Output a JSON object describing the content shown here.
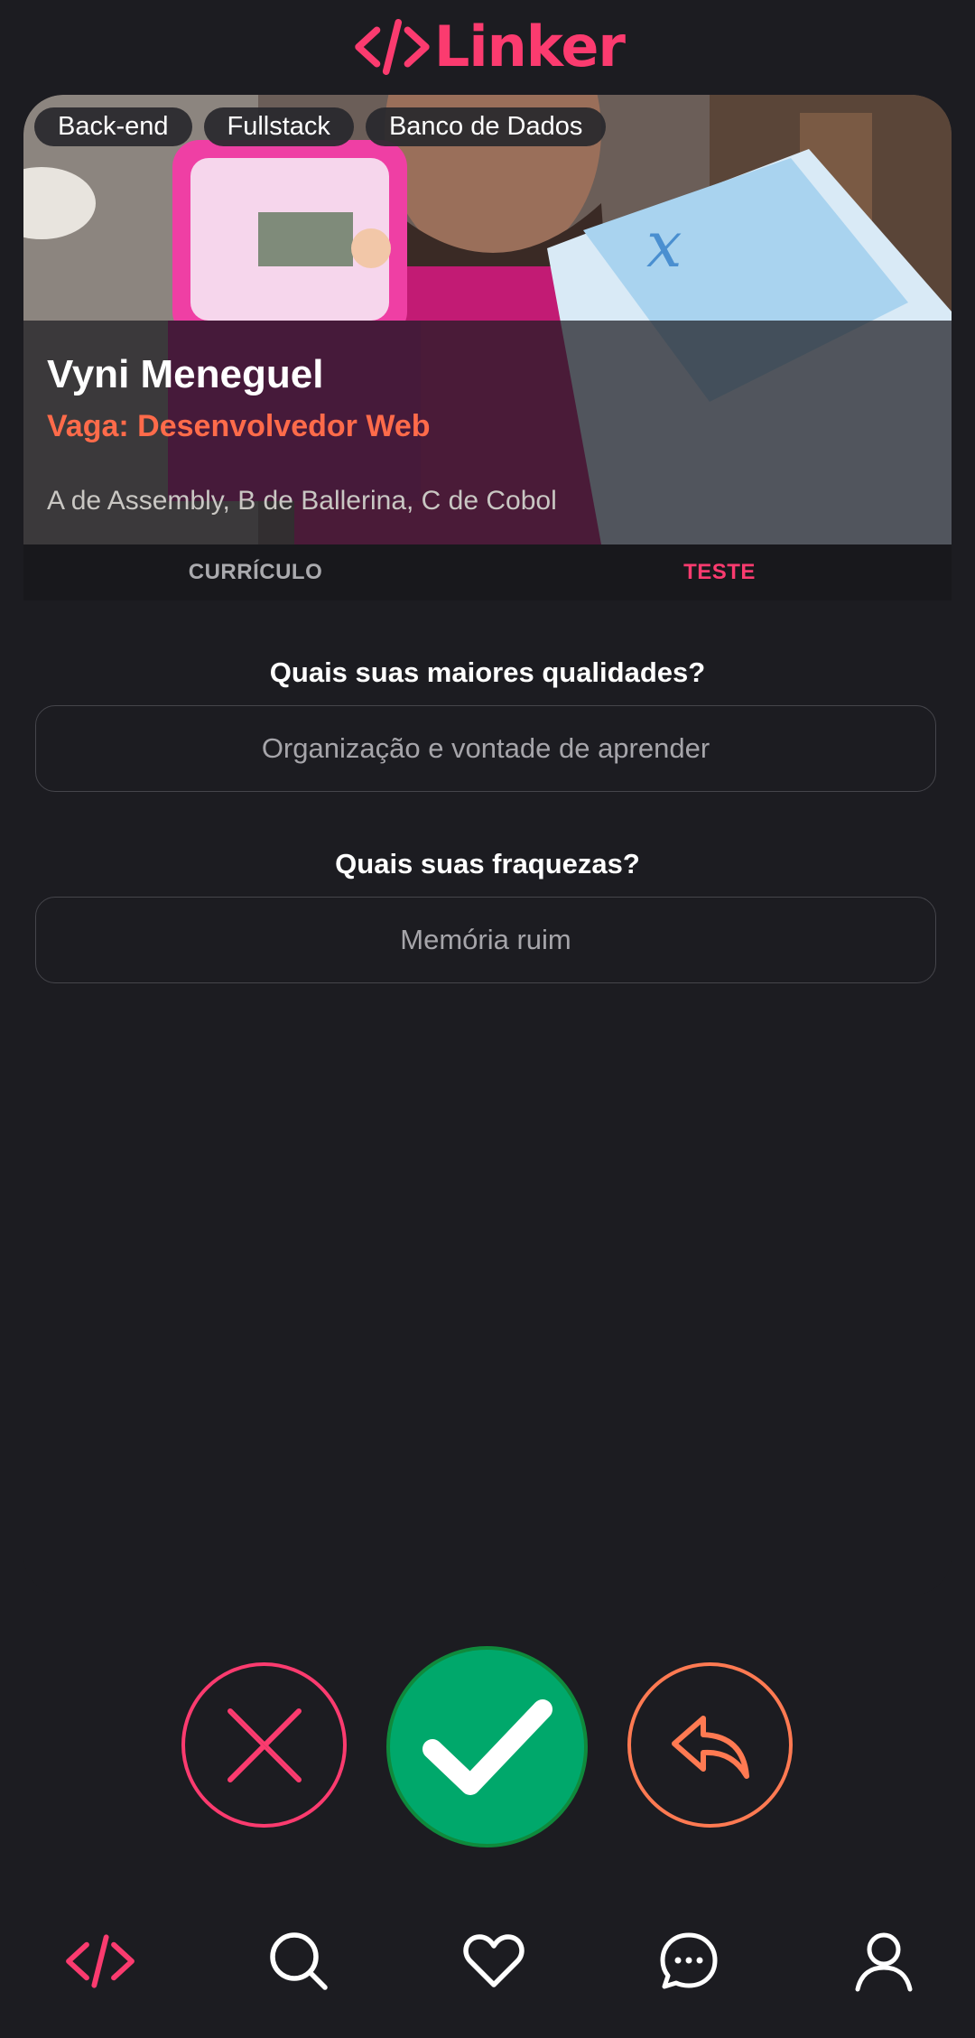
{
  "app": {
    "name": "Linker",
    "brand_color": "#fb3b6f",
    "accent_color": "#ff6b4a",
    "success_color": "#00a86b"
  },
  "profile": {
    "tags": [
      "Back-end",
      "Fullstack",
      "Banco de Dados"
    ],
    "name": "Vyni Meneguel",
    "job": "Vaga: Desenvolvedor Web",
    "bio": "A de Assembly, B de Ballerina, C de Cobol"
  },
  "tabs": [
    {
      "label": "CURRÍCULO",
      "active": false
    },
    {
      "label": "TESTE",
      "active": true
    }
  ],
  "test": {
    "questions": [
      {
        "question": "Quais suas maiores qualidades?",
        "answer": "Organização e vontade de aprender"
      },
      {
        "question": "Quais suas fraquezas?",
        "answer": "Memória ruim"
      }
    ]
  },
  "actions": {
    "reject_icon": "close-icon",
    "accept_icon": "check-icon",
    "back_icon": "undo-icon"
  },
  "bottom_nav": [
    {
      "icon": "code-icon",
      "active": true
    },
    {
      "icon": "search-icon",
      "active": false
    },
    {
      "icon": "heart-icon",
      "active": false
    },
    {
      "icon": "chat-icon",
      "active": false
    },
    {
      "icon": "user-icon",
      "active": false
    }
  ]
}
